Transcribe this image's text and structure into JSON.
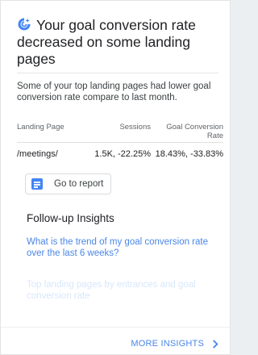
{
  "insight": {
    "title": "Your goal conversion rate decreased on some landing pages",
    "title_icon": "insights-sparkle-icon",
    "description": "Some of your top landing pages had lower goal conversion rate compare to last month.",
    "accent_color": "#4285f4",
    "link_color": "#4a86e8"
  },
  "table": {
    "headers": {
      "page": "Landing Page",
      "sessions": "Sessions",
      "goal": "Goal Conversion Rate"
    },
    "rows": [
      {
        "page": "/meetings/",
        "sessions": "1.5K, -22.25%",
        "goal": "18.43%, -33.83%"
      }
    ]
  },
  "actions": {
    "report_icon": "report-icon",
    "report_label": "Go to report"
  },
  "followup": {
    "heading": "Follow-up Insights",
    "items": [
      "What is the trend of my goal conversion rate over the last 6 weeks?",
      "Top landing pages by entrances and goal conversion rate"
    ]
  },
  "footer": {
    "more_label": "MORE INSIGHTS",
    "more_icon": "chevron-right-icon"
  }
}
